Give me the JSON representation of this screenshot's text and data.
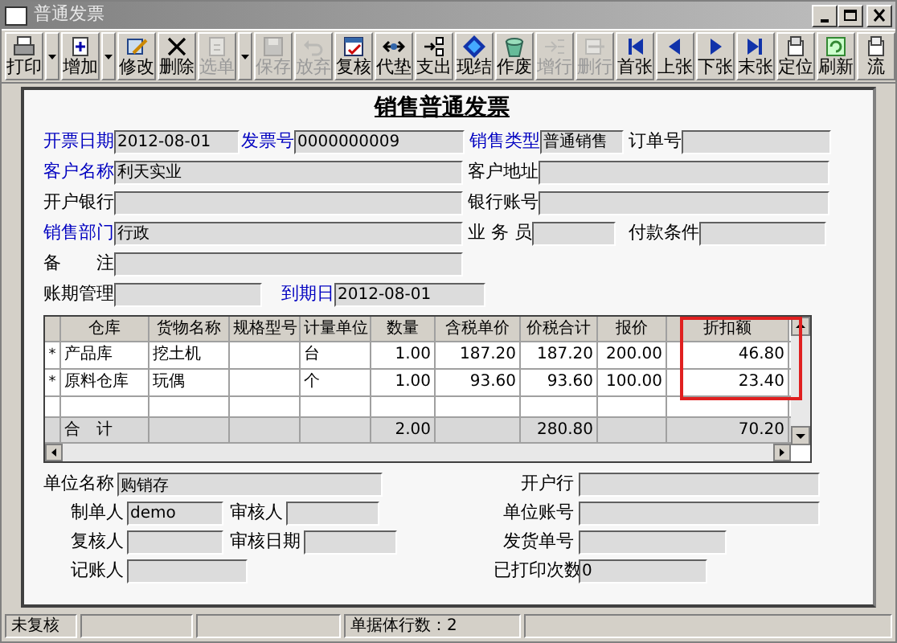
{
  "window": {
    "title": "普通发票"
  },
  "toolbar": [
    {
      "label": "打印",
      "disabled": false,
      "dropdown": true
    },
    {
      "label": "增加",
      "disabled": false,
      "dropdown": true
    },
    {
      "label": "修改",
      "disabled": false,
      "dropdown": false
    },
    {
      "label": "删除",
      "disabled": false,
      "dropdown": false
    },
    {
      "label": "选单",
      "disabled": true,
      "dropdown": true
    },
    {
      "label": "保存",
      "disabled": true,
      "dropdown": false
    },
    {
      "label": "放弃",
      "disabled": true,
      "dropdown": false
    },
    {
      "label": "复核",
      "disabled": false,
      "dropdown": false
    },
    {
      "label": "代垫",
      "disabled": false,
      "dropdown": false
    },
    {
      "label": "支出",
      "disabled": false,
      "dropdown": false
    },
    {
      "label": "现结",
      "disabled": false,
      "dropdown": false
    },
    {
      "label": "作废",
      "disabled": false,
      "dropdown": false
    },
    {
      "label": "增行",
      "disabled": true,
      "dropdown": false
    },
    {
      "label": "删行",
      "disabled": true,
      "dropdown": false
    },
    {
      "label": "首张",
      "disabled": false,
      "dropdown": false
    },
    {
      "label": "上张",
      "disabled": false,
      "dropdown": false
    },
    {
      "label": "下张",
      "disabled": false,
      "dropdown": false
    },
    {
      "label": "末张",
      "disabled": false,
      "dropdown": false
    },
    {
      "label": "定位",
      "disabled": false,
      "dropdown": false
    },
    {
      "label": "刷新",
      "disabled": false,
      "dropdown": false
    },
    {
      "label": "流",
      "disabled": false,
      "dropdown": false
    }
  ],
  "form_title": "销售普通发票",
  "header_rows": [
    [
      {
        "label": "开票日期",
        "value": "2012-08-01",
        "required": true
      },
      {
        "label": "发票号",
        "value": "0000000009",
        "required": true
      },
      {
        "label": "销售类型",
        "value": "普通销售",
        "required": true
      },
      {
        "label": "订单号",
        "required": false
      }
    ],
    [
      {
        "label": "客户名称",
        "value": "利天实业",
        "required": true
      },
      {
        "label": "客户地址",
        "required": false
      }
    ],
    [
      {
        "label": "开户银行",
        "required": false
      },
      {
        "label": "银行账号",
        "required": false
      }
    ],
    [
      {
        "label": "销售部门",
        "value": "行政",
        "required": true
      },
      {
        "label": "业 务 员",
        "required": false
      },
      {
        "label": "付款条件",
        "required": false
      }
    ],
    [
      {
        "label": "备　　注",
        "required": false
      }
    ],
    [
      {
        "label": "账期管理",
        "required": false
      },
      {
        "label": "到期日",
        "value": "2012-08-01",
        "required": true
      }
    ]
  ],
  "table": {
    "columns": [
      {
        "label": "仓库",
        "highlighted": false
      },
      {
        "label": "货物名称",
        "highlighted": false
      },
      {
        "label": "规格型号",
        "highlighted": false
      },
      {
        "label": "计量单位",
        "highlighted": false
      },
      {
        "label": "数量",
        "highlighted": false
      },
      {
        "label": "含税单价",
        "highlighted": false
      },
      {
        "label": "价税合计",
        "highlighted": false
      },
      {
        "label": "报价",
        "highlighted": false
      },
      {
        "label": "折扣额",
        "highlighted": true
      }
    ],
    "rows": [
      {
        "marker": "*",
        "cells": [
          "产品库",
          "挖土机",
          null,
          "台",
          "1.00",
          "187.20",
          "187.20",
          "200.00",
          "46.80"
        ]
      },
      {
        "marker": "*",
        "cells": [
          "原料仓库",
          "玩偶",
          null,
          "个",
          "1.00",
          "93.60",
          "93.60",
          "100.00",
          "23.40"
        ]
      }
    ],
    "total": {
      "cells": [
        "合　计",
        null,
        null,
        null,
        "2.00",
        null,
        "280.80",
        null,
        "70.20"
      ]
    }
  },
  "footer_rows": [
    {
      "left": [
        {
          "label": "单位名称",
          "value": "购销存"
        }
      ],
      "right": {
        "label": "开户行"
      }
    },
    {
      "left": [
        {
          "label": "制单人",
          "value": "demo"
        },
        {
          "label": "审核人"
        }
      ],
      "right": {
        "label": "单位账号"
      }
    },
    {
      "left": [
        {
          "label": "复核人"
        },
        {
          "label": "审核日期"
        }
      ],
      "right": {
        "label": "发货单号"
      }
    },
    {
      "left": [
        {
          "label": "记账人"
        }
      ],
      "right": {
        "label": "已打印次数",
        "value": "0"
      }
    }
  ],
  "status_bar": [
    "未复核",
    "单据体行数：2"
  ]
}
